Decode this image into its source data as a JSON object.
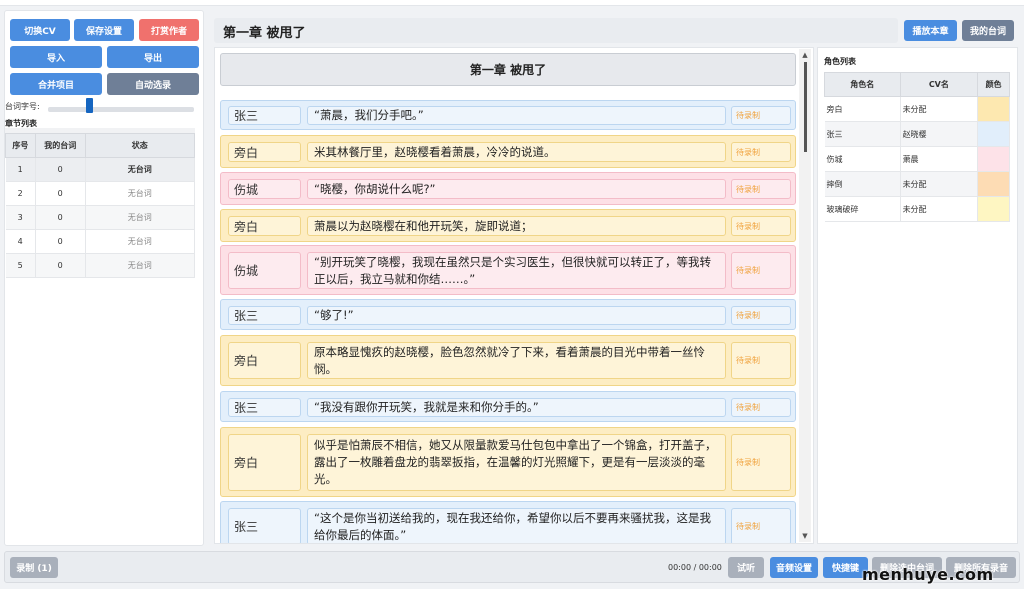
{
  "left_panel": {
    "buttons": {
      "switch_cv": "切换CV",
      "save_settings": "保存设置",
      "tip_author": "打赏作者",
      "import": "导入",
      "export": "导出",
      "merge_project": "合并项目",
      "auto_select": "自动选录"
    },
    "slider_label": "台词字号:",
    "font_size_slider_fraction": 0.26,
    "chapter_list_title": "章节列表",
    "chapter_table": {
      "headers": [
        "序号",
        "我的台词",
        "状态"
      ],
      "rows": [
        {
          "index": "1",
          "count": "0",
          "status": "无台词"
        },
        {
          "index": "2",
          "count": "0",
          "status": "无台词"
        },
        {
          "index": "3",
          "count": "0",
          "status": "无台词"
        },
        {
          "index": "4",
          "count": "0",
          "status": "无台词"
        },
        {
          "index": "5",
          "count": "0",
          "status": "无台词"
        }
      ]
    }
  },
  "header": {
    "chapter_title": "第一章 被甩了",
    "play_chapter": "播放本章",
    "my_lines": "我的台词"
  },
  "script": {
    "heading": "第一章 被甩了",
    "lines": [
      {
        "role": "张三",
        "role_key": "zhang",
        "text": "“萧晨，我们分手吧。”",
        "status": "待录制"
      },
      {
        "role": "旁白",
        "role_key": "pang",
        "text": "米其林餐厅里，赵晓樱看着萧晨，冷冷的说道。",
        "status": "待录制"
      },
      {
        "role": "伤城",
        "role_key": "wei",
        "text": "“晓樱，你胡说什么呢?”",
        "status": "待录制"
      },
      {
        "role": "旁白",
        "role_key": "pang",
        "text": "萧晨以为赵晓樱在和他开玩笑，旋即说道；",
        "status": "待录制"
      },
      {
        "role": "伤城",
        "role_key": "wei",
        "text": "“别开玩笑了晓樱，我现在虽然只是个实习医生，但很快就可以转正了，等我转正以后，我立马就和你结……。”",
        "status": "待录制"
      },
      {
        "role": "张三",
        "role_key": "zhang",
        "text": "“够了!”",
        "status": "待录制"
      },
      {
        "role": "旁白",
        "role_key": "pang",
        "text": "原本略显愧疚的赵晓樱，脸色忽然就冷了下来，看着萧晨的目光中带着一丝怜悯。",
        "status": "待录制"
      },
      {
        "role": "张三",
        "role_key": "zhang",
        "text": "“我没有跟你开玩笑，我就是来和你分手的。”",
        "status": "待录制"
      },
      {
        "role": "旁白",
        "role_key": "pang",
        "text": "似乎是怕萧辰不相信，她又从限量款爱马仕包包中拿出了一个锦盒，打开盖子，露出了一枚雕着盘龙的翡翠扳指，在温馨的灯光照耀下，更是有一层淡淡的毫光。",
        "status": "待录制"
      },
      {
        "role": "张三",
        "role_key": "zhang",
        "text": "“这个是你当初送给我的，现在我还给你，希望你以后不要再来骚扰我，这是我给你最后的体面。”",
        "status": "待录制"
      }
    ]
  },
  "role_panel": {
    "title": "角色列表",
    "headers": [
      "角色名",
      "CV名",
      "颜色"
    ],
    "rows": [
      {
        "name": "旁白",
        "cv": "未分配",
        "color": "#fde8b0"
      },
      {
        "name": "张三",
        "cv": "赵晓樱",
        "color": "#e1eefb"
      },
      {
        "name": "伤城",
        "cv": "萧晨",
        "color": "#fde2e8"
      },
      {
        "name": "摔倒",
        "cv": "未分配",
        "color": "#fddcb4"
      },
      {
        "name": "玻璃破碎",
        "cv": "未分配",
        "color": "#fef6c2"
      }
    ]
  },
  "bottom_bar": {
    "record": "录制 (1)",
    "time": "00:00 / 00:00",
    "audition": "试听",
    "audio_settings": "音频设置",
    "shortcuts": "快捷键",
    "extra1": "删除选中台词",
    "extra2": "删除所有录音"
  },
  "watermark": "menhuye.com"
}
